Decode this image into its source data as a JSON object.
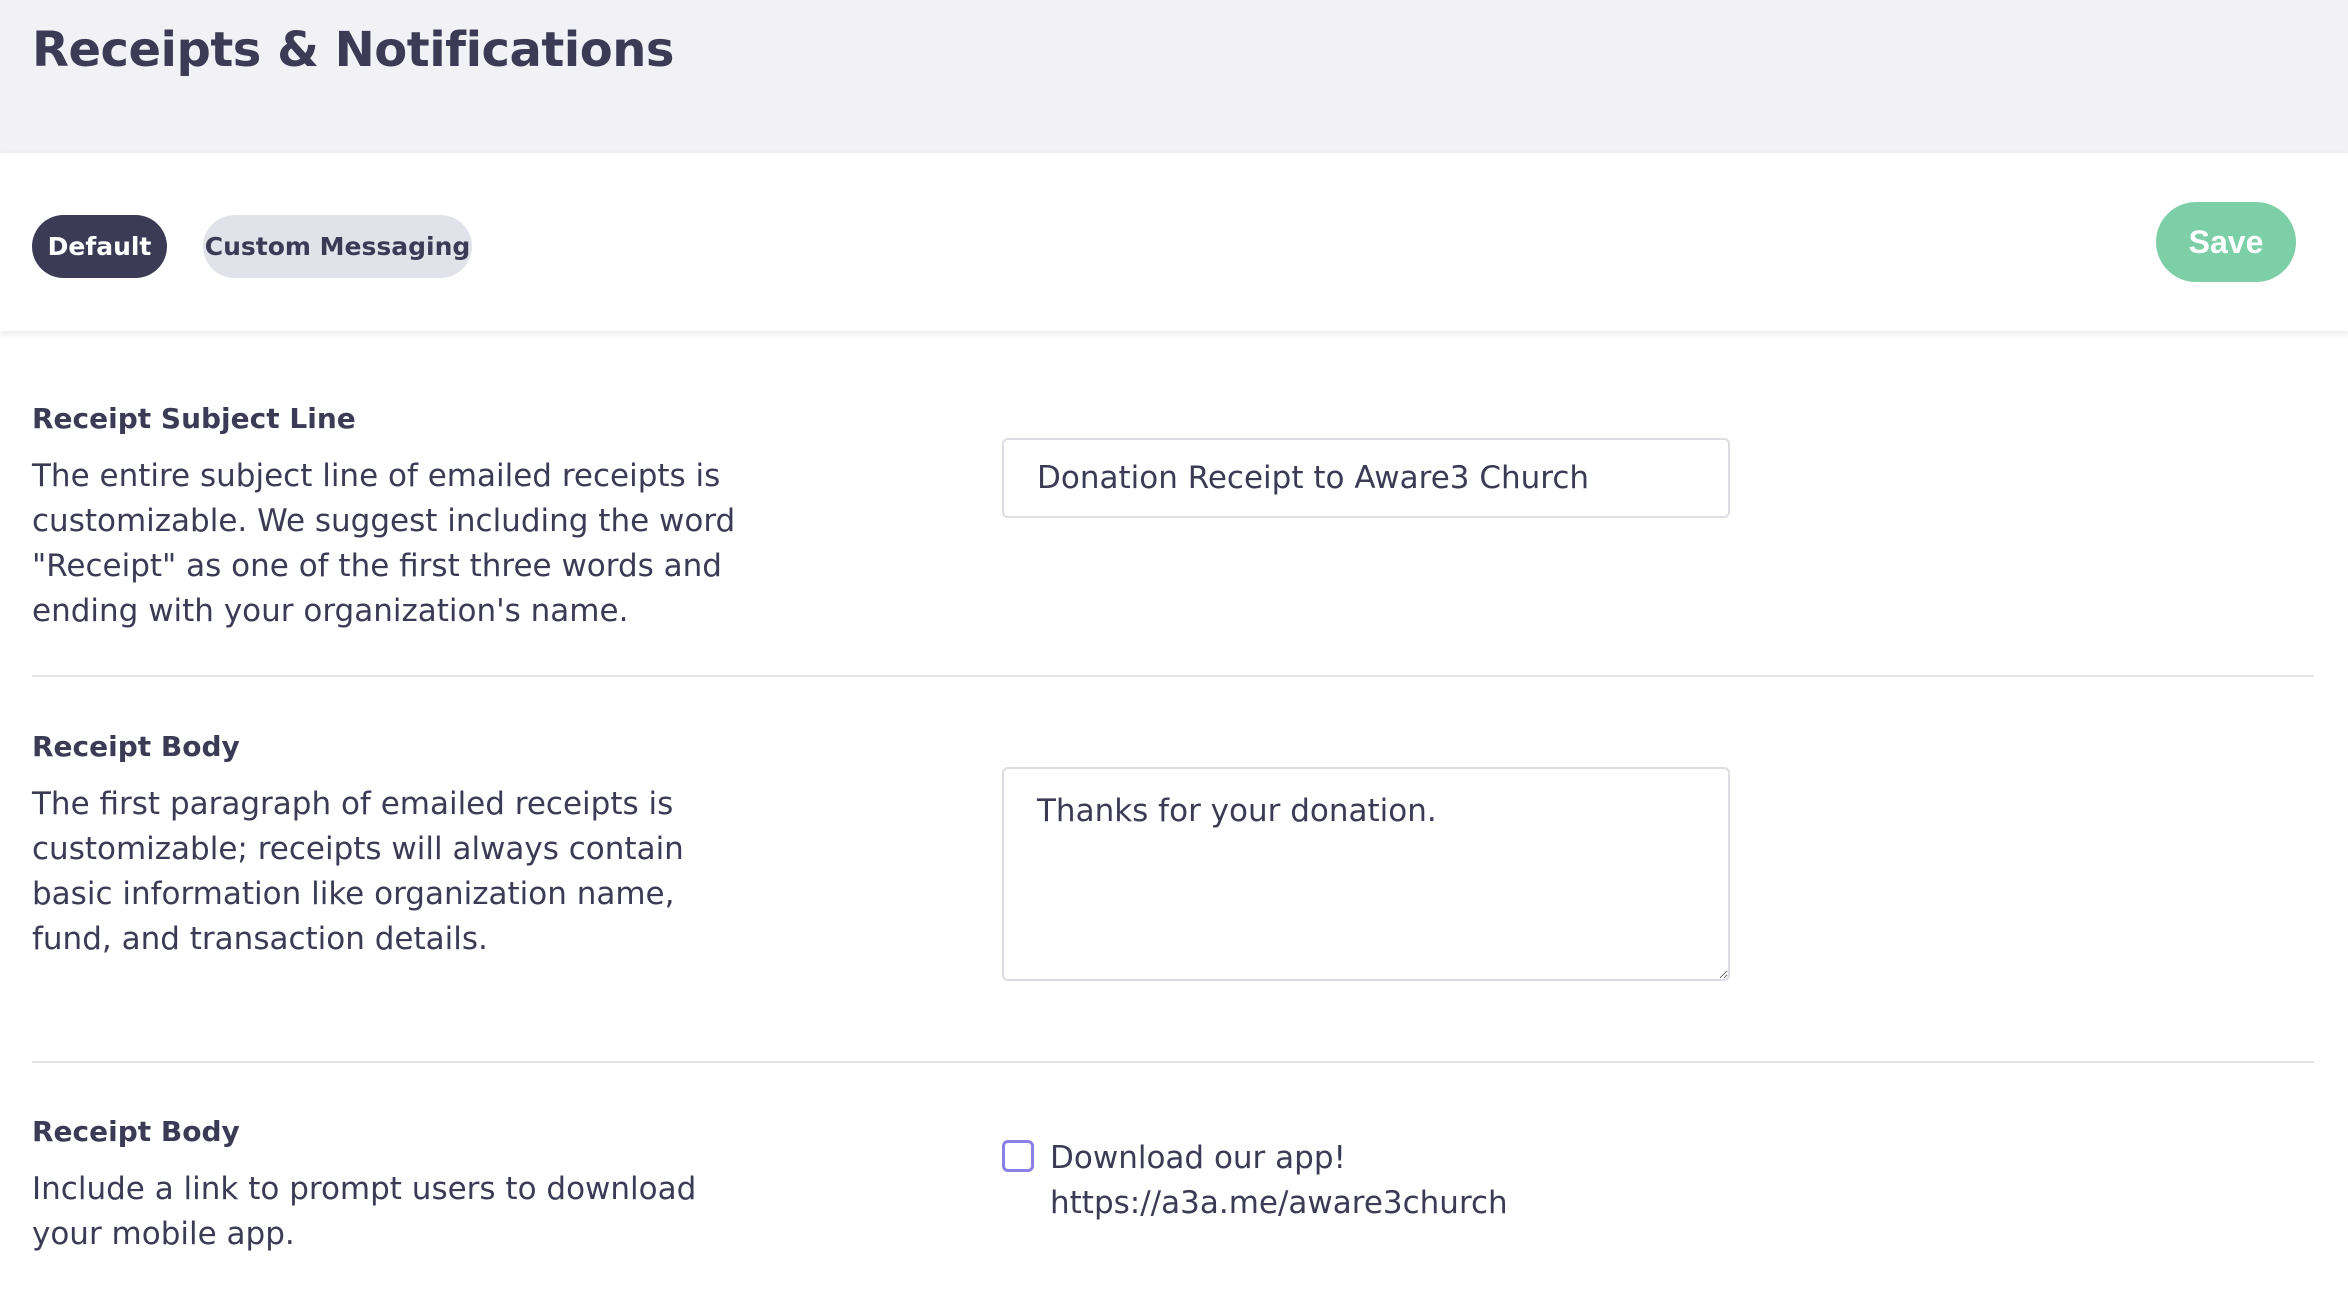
{
  "header": {
    "title": "Receipts & Notifications"
  },
  "tabs": [
    {
      "label": "Default",
      "active": true
    },
    {
      "label": "Custom Messaging",
      "active": false
    }
  ],
  "toolbar": {
    "save_label": "Save"
  },
  "sections": {
    "subject": {
      "title": "Receipt Subject Line",
      "description": "The entire subject line of emailed receipts is customizable. We suggest including the word \"Receipt\" as one of the first three words and ending with your organization's name.",
      "value": "Donation Receipt to Aware3 Church"
    },
    "body": {
      "title": "Receipt Body",
      "description": "The first paragraph of emailed receipts is customizable; receipts will always contain basic information like organization name, fund, and transaction details.",
      "value": "Thanks for your donation."
    },
    "app_link": {
      "title": "Receipt Body",
      "description": "Include a link to prompt users to download your mobile app.",
      "checkbox_label": "Download our app!",
      "checkbox_url": "https://a3a.me/aware3church",
      "checked": false
    }
  },
  "colors": {
    "header_bg": "#f1f1f6",
    "primary_dark": "#3b3b55",
    "save_green": "#7ccfa6",
    "checkbox_accent": "#8b80e6"
  }
}
